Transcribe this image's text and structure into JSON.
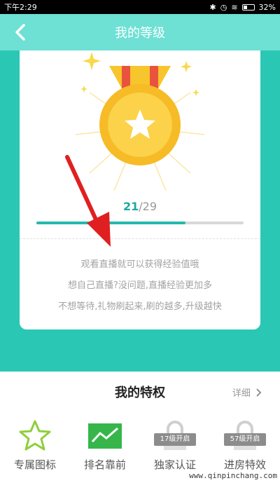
{
  "status_bar": {
    "time": "下午2:29",
    "battery": "32%"
  },
  "nav": {
    "title": "我的等级"
  },
  "level": {
    "current": "21",
    "total": "/29",
    "progress_fraction": 0.72
  },
  "tips": [
    "观看直播就可以获得经验值哦",
    "想自己直播?没问题,直播经验更加多",
    "不想等待,礼物刷起来,刷的越多,升级越快"
  ],
  "privileges": {
    "title": "我的特权",
    "more_label": "详细",
    "items": [
      {
        "label": "专属图标",
        "icon": "star-outline-icon",
        "locked": false
      },
      {
        "label": "排名靠前",
        "icon": "trend-chart-icon",
        "locked": false
      },
      {
        "label": "独家认证",
        "icon": "lock-icon",
        "locked": true,
        "badge": "17级开启"
      },
      {
        "label": "进房特效",
        "icon": "lock-icon",
        "locked": true,
        "badge": "57级开启"
      }
    ]
  },
  "watermark": "www.qinpinchang.com",
  "colors": {
    "teal": "#2ac8b4",
    "nav": "#6ee0d4",
    "progress": "#23b9ae",
    "gold": "#f8c62a",
    "arrow": "#e02020"
  }
}
